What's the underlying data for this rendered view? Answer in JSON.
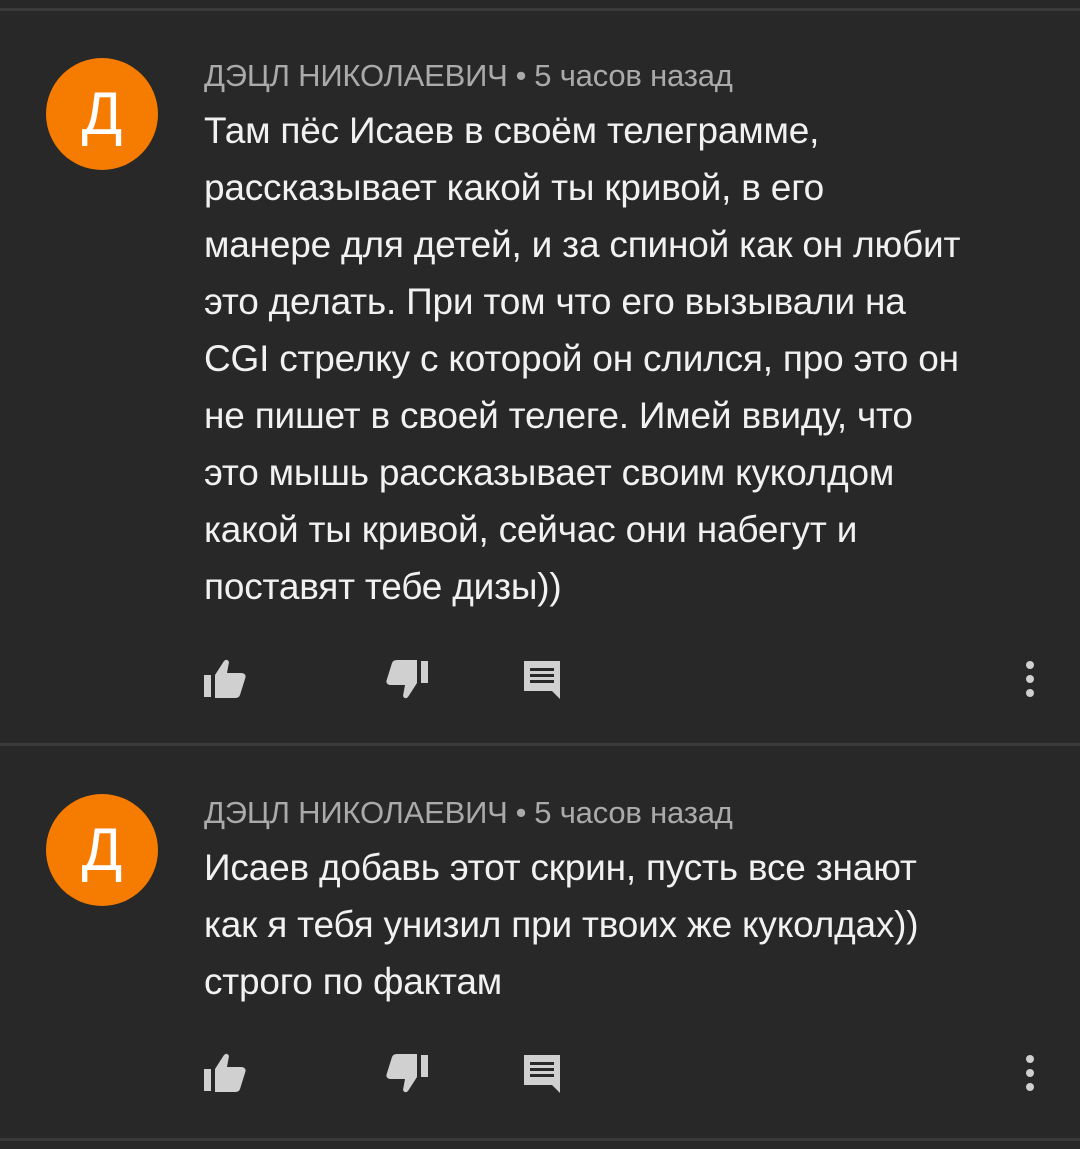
{
  "comments": [
    {
      "avatar_letter": "Д",
      "author": "ДЭЦЛ НИКОЛАЕВИЧ",
      "separator": "•",
      "time": "5 часов назад",
      "text": "Там пёс Исаев в своём телеграмме,\nрассказывает какой ты кривой, в его\nманере для детей, и за спиной как он любит\nэто делать. При том что его вызывали на\nCGI стрелку с которой он слился, про это он\nне пишет в своей телеге. Имей ввиду, что\nэто мышь рассказывает своим куколдом\nкакой ты кривой, сейчас они набегут и\nпоставят тебе дизы))"
    },
    {
      "avatar_letter": "Д",
      "author": "ДЭЦЛ НИКОЛАЕВИЧ",
      "separator": "•",
      "time": "5 часов назад",
      "text": "Исаев добавь этот скрин, пусть все знают\nкак я тебя унизил при твоих же куколдах))\nстрого по фактам"
    }
  ],
  "icons": {
    "like": "thumbs-up-icon",
    "dislike": "thumbs-down-icon",
    "reply": "comment-icon",
    "more": "more-vert-icon"
  },
  "colors": {
    "background": "#282828",
    "avatar": "#f57c00",
    "text": "#f1f1f1",
    "meta": "#aaaaaa",
    "icon": "#d0d0d0",
    "divider": "#3a3a3a"
  }
}
